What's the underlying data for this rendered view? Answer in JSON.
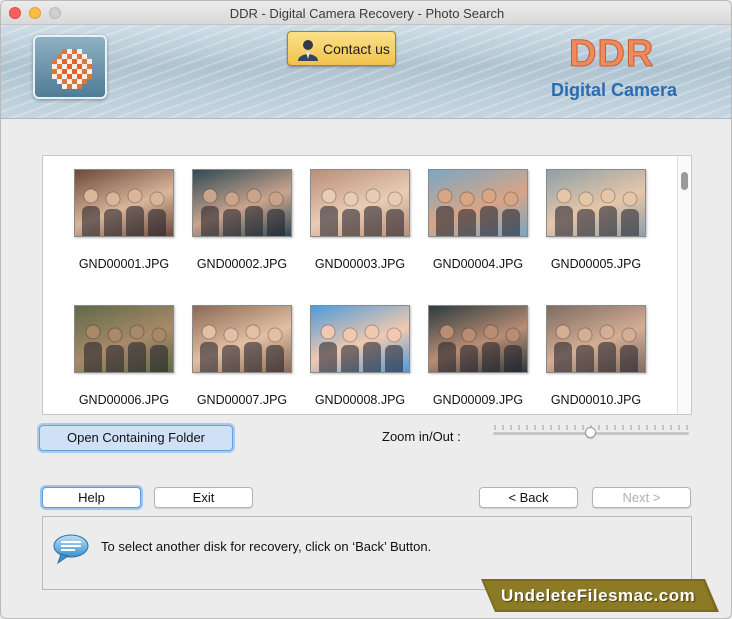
{
  "window": {
    "title": "DDR - Digital Camera Recovery - Photo Search"
  },
  "banner": {
    "contact_label": "Contact us",
    "brand": "DDR",
    "brand_sub": "Digital Camera",
    "brand_color": "#f08a5d",
    "sub_color": "#2a6cb1"
  },
  "gallery": {
    "items": [
      {
        "name": "GND00001.JPG",
        "bg": "#6b4a3a",
        "fg": "#d9b59a"
      },
      {
        "name": "GND00002.JPG",
        "bg": "#2f4a56",
        "fg": "#c9a48c"
      },
      {
        "name": "GND00003.JPG",
        "bg": "#b98e78",
        "fg": "#e9ccb5"
      },
      {
        "name": "GND00004.JPG",
        "bg": "#7aa7c4",
        "fg": "#d8a585"
      },
      {
        "name": "GND00005.JPG",
        "bg": "#8fa0a8",
        "fg": "#e6c6a8"
      },
      {
        "name": "GND00006.JPG",
        "bg": "#5f6a48",
        "fg": "#a88a6a"
      },
      {
        "name": "GND00007.JPG",
        "bg": "#8a6a55",
        "fg": "#e3bfa3"
      },
      {
        "name": "GND00008.JPG",
        "bg": "#4f9ad8",
        "fg": "#f0c9b0"
      },
      {
        "name": "GND00009.JPG",
        "bg": "#2d3b3f",
        "fg": "#b98d74"
      },
      {
        "name": "GND00010.JPG",
        "bg": "#7e6b62",
        "fg": "#d4ae95"
      }
    ]
  },
  "controls": {
    "open_folder_label": "Open Containing Folder",
    "zoom_label": "Zoom in/Out :",
    "zoom_level": 0.5,
    "help_label": "Help",
    "exit_label": "Exit",
    "back_label": "< Back",
    "next_label": "Next >"
  },
  "status": {
    "message": "To select another disk for recovery, click on ‘Back’ Button."
  },
  "watermark": {
    "text": "UndeleteFilesmac.com"
  }
}
